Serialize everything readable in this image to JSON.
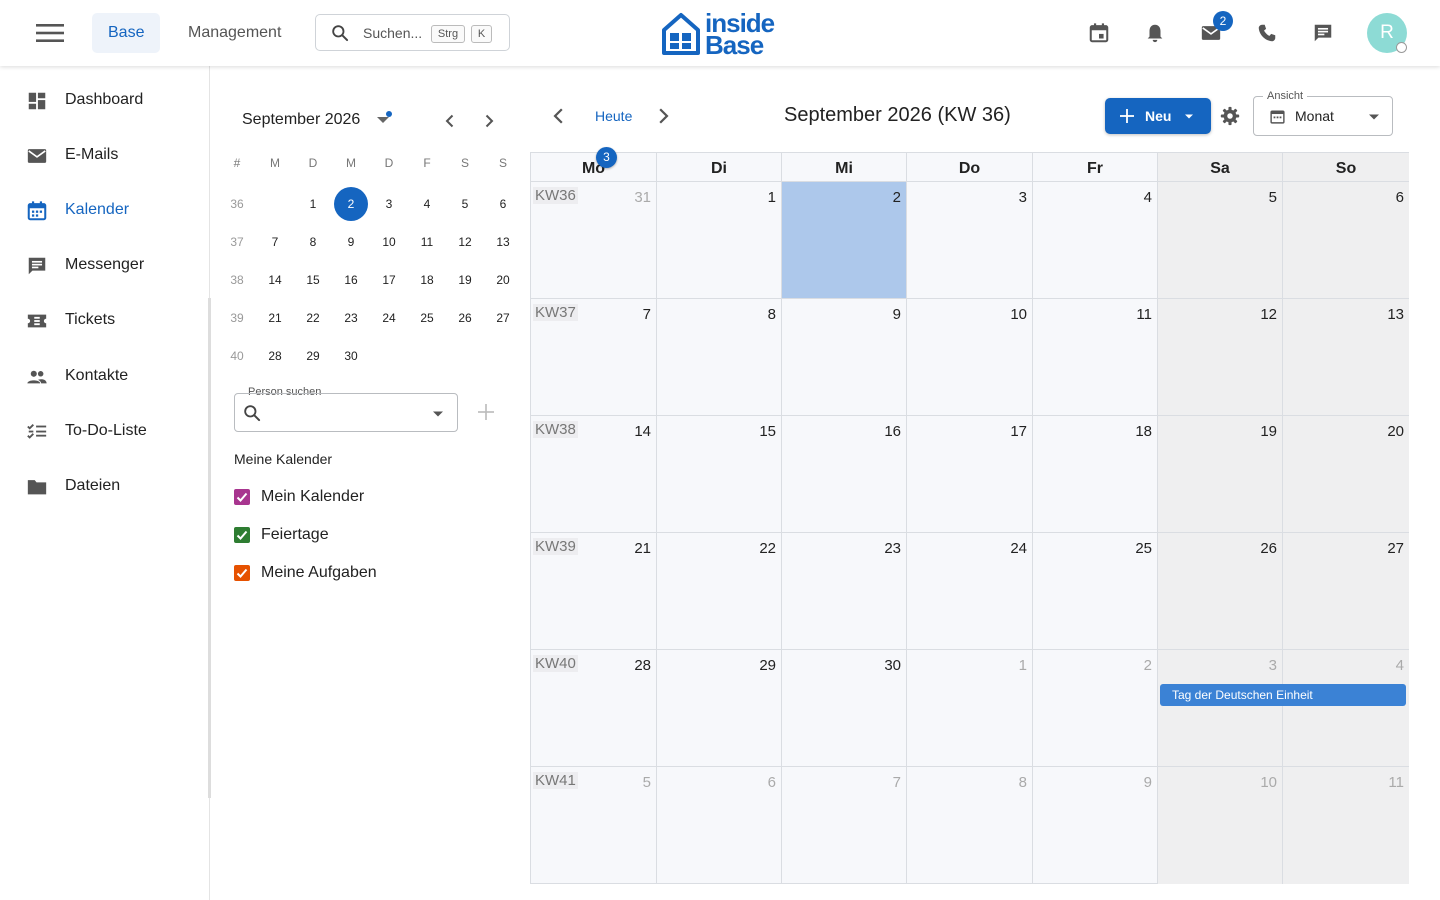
{
  "header": {
    "tabs": [
      {
        "label": "Base",
        "active": true
      },
      {
        "label": "Management",
        "active": false
      }
    ],
    "search": {
      "placeholder": "Suchen...",
      "shortcut_key1": "Strg",
      "shortcut_key2": "K"
    },
    "logo": {
      "line1": "inside",
      "line2": "Base"
    },
    "icons": [
      "calendar-icon",
      "bell-icon",
      "mail-icon",
      "phone-icon",
      "chat-icon"
    ],
    "mail_badge": "2",
    "avatar_initial": "R",
    "colors": {
      "accent": "#1565c0",
      "avatar": "#8ddbd5"
    }
  },
  "sidebar": {
    "items": [
      {
        "label": "Dashboard",
        "icon": "dashboard-icon",
        "active": false
      },
      {
        "label": "E-Mails",
        "icon": "mail-icon",
        "active": false
      },
      {
        "label": "Kalender",
        "icon": "calendar-icon",
        "active": true
      },
      {
        "label": "Messenger",
        "icon": "chat-icon",
        "active": false
      },
      {
        "label": "Tickets",
        "icon": "ticket-icon",
        "active": false
      },
      {
        "label": "Kontakte",
        "icon": "people-icon",
        "active": false
      },
      {
        "label": "To-Do-Liste",
        "icon": "checklist-icon",
        "active": false
      },
      {
        "label": "Dateien",
        "icon": "folder-icon",
        "active": false
      }
    ]
  },
  "mini_calendar": {
    "title": "September 2026",
    "headers": [
      "#",
      "M",
      "D",
      "M",
      "D",
      "F",
      "S",
      "S"
    ],
    "weeks": [
      {
        "kw": "36",
        "days": [
          "",
          "1",
          "2",
          "3",
          "4",
          "5",
          "6"
        ]
      },
      {
        "kw": "37",
        "days": [
          "7",
          "8",
          "9",
          "10",
          "11",
          "12",
          "13"
        ]
      },
      {
        "kw": "38",
        "days": [
          "14",
          "15",
          "16",
          "17",
          "18",
          "19",
          "20"
        ]
      },
      {
        "kw": "39",
        "days": [
          "21",
          "22",
          "23",
          "24",
          "25",
          "26",
          "27"
        ]
      },
      {
        "kw": "40",
        "days": [
          "28",
          "29",
          "30",
          "",
          "",
          "",
          ""
        ]
      }
    ],
    "selected_day": "2"
  },
  "person_search": {
    "label": "Person suchen",
    "value": ""
  },
  "my_calendars": {
    "title": "Meine Kalender",
    "items": [
      {
        "label": "Mein Kalender",
        "color": "#a8358f",
        "checked": true
      },
      {
        "label": "Feiertage",
        "color": "#2e7d32",
        "checked": true
      },
      {
        "label": "Meine Aufgaben",
        "color": "#e65100",
        "checked": true
      }
    ]
  },
  "toolbar": {
    "today_label": "Heute",
    "period_title": "September 2026 (KW 36)",
    "new_label": "Neu",
    "view_label": "Ansicht",
    "view_value": "Monat"
  },
  "month": {
    "day_headers": [
      "Mo",
      "Di",
      "Mi",
      "Do",
      "Fr",
      "Sa",
      "So"
    ],
    "more_badge": "3",
    "weeks": [
      {
        "kw": "KW36",
        "days": [
          {
            "d": "31",
            "other": true
          },
          {
            "d": "1"
          },
          {
            "d": "2",
            "today": true
          },
          {
            "d": "3"
          },
          {
            "d": "4"
          },
          {
            "d": "5"
          },
          {
            "d": "6"
          }
        ]
      },
      {
        "kw": "KW37",
        "days": [
          {
            "d": "7"
          },
          {
            "d": "8"
          },
          {
            "d": "9"
          },
          {
            "d": "10"
          },
          {
            "d": "11"
          },
          {
            "d": "12"
          },
          {
            "d": "13"
          }
        ]
      },
      {
        "kw": "KW38",
        "days": [
          {
            "d": "14"
          },
          {
            "d": "15"
          },
          {
            "d": "16"
          },
          {
            "d": "17"
          },
          {
            "d": "18"
          },
          {
            "d": "19"
          },
          {
            "d": "20"
          }
        ]
      },
      {
        "kw": "KW39",
        "days": [
          {
            "d": "21"
          },
          {
            "d": "22"
          },
          {
            "d": "23"
          },
          {
            "d": "24"
          },
          {
            "d": "25"
          },
          {
            "d": "26"
          },
          {
            "d": "27"
          }
        ]
      },
      {
        "kw": "KW40",
        "days": [
          {
            "d": "28"
          },
          {
            "d": "29"
          },
          {
            "d": "30"
          },
          {
            "d": "1",
            "other": true
          },
          {
            "d": "2",
            "other": true
          },
          {
            "d": "3",
            "other": true
          },
          {
            "d": "4",
            "other": true
          }
        ]
      },
      {
        "kw": "KW41",
        "days": [
          {
            "d": "5",
            "other": true
          },
          {
            "d": "6",
            "other": true
          },
          {
            "d": "7",
            "other": true
          },
          {
            "d": "8",
            "other": true
          },
          {
            "d": "9",
            "other": true
          },
          {
            "d": "10",
            "other": true
          },
          {
            "d": "11",
            "other": true
          }
        ]
      }
    ],
    "events": [
      {
        "title": "Tag der Deutschen Einheit",
        "color": "#3b82d5"
      }
    ]
  }
}
